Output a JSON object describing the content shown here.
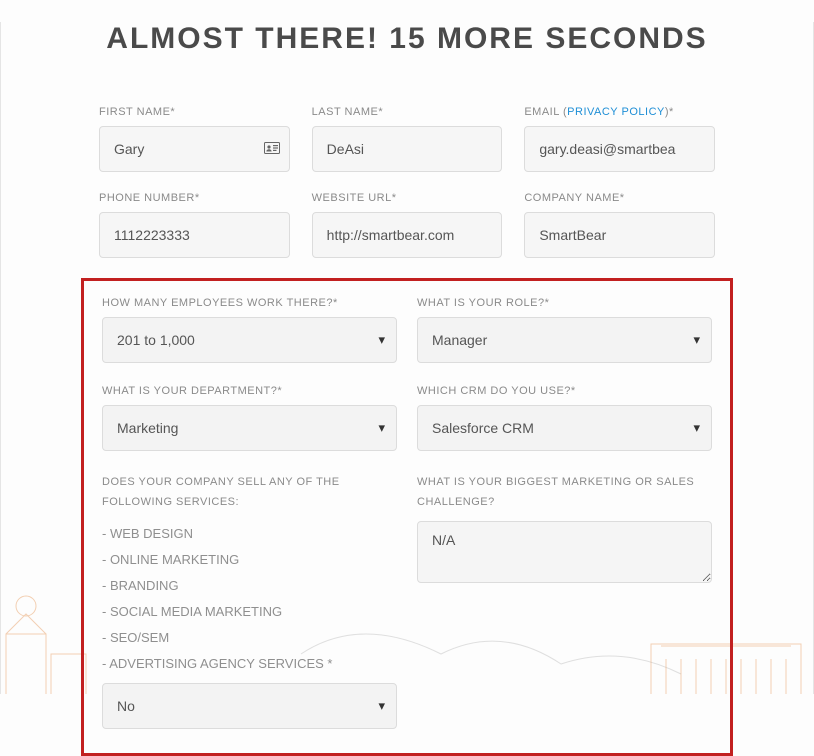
{
  "title": "ALMOST THERE! 15 MORE SECONDS",
  "fields": {
    "first_name": {
      "label": "FIRST NAME*",
      "value": "Gary"
    },
    "last_name": {
      "label": "LAST NAME*",
      "value": "DeAsi"
    },
    "email": {
      "label_pre": "EMAIL (",
      "policy_text": "PRIVACY POLICY",
      "label_post": ")*",
      "value": "gary.deasi@smartbea"
    },
    "phone": {
      "label": "PHONE NUMBER*",
      "value": "1112223333"
    },
    "website": {
      "label": "WEBSITE URL*",
      "value": "http://smartbear.com"
    },
    "company": {
      "label": "COMPANY NAME*",
      "value": "SmartBear"
    },
    "employees": {
      "label": "HOW MANY EMPLOYEES WORK THERE?*",
      "value": "201 to 1,000"
    },
    "role": {
      "label": "WHAT IS YOUR ROLE?*",
      "value": "Manager"
    },
    "department": {
      "label": "WHAT IS YOUR DEPARTMENT?*",
      "value": "Marketing"
    },
    "crm": {
      "label": "WHICH CRM DO YOU USE?*",
      "value": "Salesforce CRM"
    },
    "services": {
      "label": "DOES YOUR COMPANY SELL ANY OF THE FOLLOWING SERVICES:",
      "lines": [
        "- WEB DESIGN",
        "- ONLINE MARKETING",
        "- BRANDING",
        "- SOCIAL MEDIA MARKETING",
        "- SEO/SEM",
        "- ADVERTISING AGENCY SERVICES *"
      ],
      "value": "No"
    },
    "challenge": {
      "label": "WHAT IS YOUR BIGGEST MARKETING OR SALES CHALLENGE?",
      "value": "N/A"
    }
  }
}
